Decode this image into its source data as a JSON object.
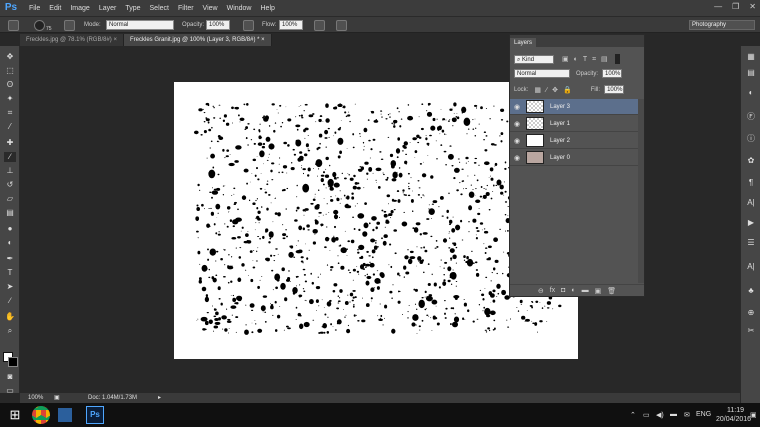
{
  "menubar": {
    "logo": "Ps",
    "items": [
      "File",
      "Edit",
      "Image",
      "Layer",
      "Type",
      "Select",
      "Filter",
      "View",
      "Window",
      "Help"
    ],
    "workspace": "Photography"
  },
  "options": {
    "brush_size": "75",
    "mode_label": "Mode:",
    "mode_value": "Normal",
    "opacity_label": "Opacity:",
    "opacity_value": "100%",
    "flow_label": "Flow:",
    "flow_value": "100%"
  },
  "tabs": [
    {
      "label": "Freckles.jpg @ 78.1% (RGB/8#)"
    },
    {
      "label": "Freckles Granit.jpg @ 100% (Layer 3, RGB/8#) *"
    }
  ],
  "layers_panel": {
    "tab": "Layers",
    "filter": "Kind",
    "blend_mode": "Normal",
    "opacity_label": "Opacity:",
    "opacity": "100%",
    "lock_label": "Lock:",
    "fill_label": "Fill:",
    "fill": "100%",
    "layers": [
      {
        "name": "Layer 3",
        "selected": true
      },
      {
        "name": "Layer 1",
        "selected": false
      },
      {
        "name": "Layer 2",
        "selected": false
      },
      {
        "name": "Layer 0",
        "selected": false
      }
    ]
  },
  "status": {
    "zoom": "100%",
    "doc": "Doc: 1.04M/1.73M"
  },
  "taskbar": {
    "lang": "ENG",
    "time": "11:19",
    "date": "20/04/2016"
  }
}
